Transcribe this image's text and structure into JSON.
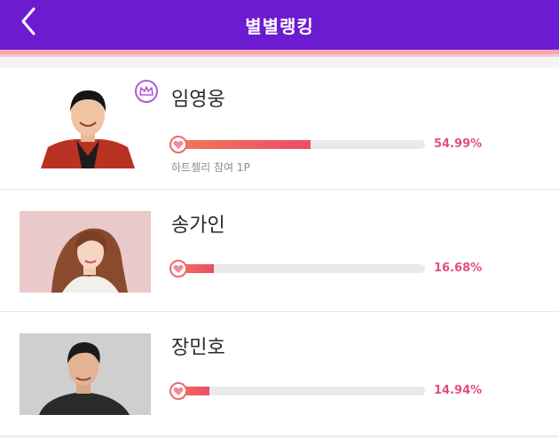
{
  "header": {
    "title": "별별랭킹",
    "back_icon": "chevron-left-icon"
  },
  "colors": {
    "header_bg": "#6d1bd0",
    "accent_pink": "#e24f7a",
    "bar_gradient_start": "#f07a55",
    "bar_gradient_end": "#ee4b6a",
    "crown_purple": "#b25ad6"
  },
  "ranking": [
    {
      "rank": 1,
      "name": "임영웅",
      "percent_label": "54.99%",
      "percent": 54.99,
      "participation": "하트젤리 참여 1P",
      "crown_icon": "crown-icon",
      "heart_icon": "heart-icon"
    },
    {
      "rank": 2,
      "name": "송가인",
      "percent_label": "16.68%",
      "percent": 16.68,
      "heart_icon": "heart-icon"
    },
    {
      "rank": 3,
      "name": "장민호",
      "percent_label": "14.94%",
      "percent": 14.94,
      "heart_icon": "heart-icon"
    }
  ]
}
